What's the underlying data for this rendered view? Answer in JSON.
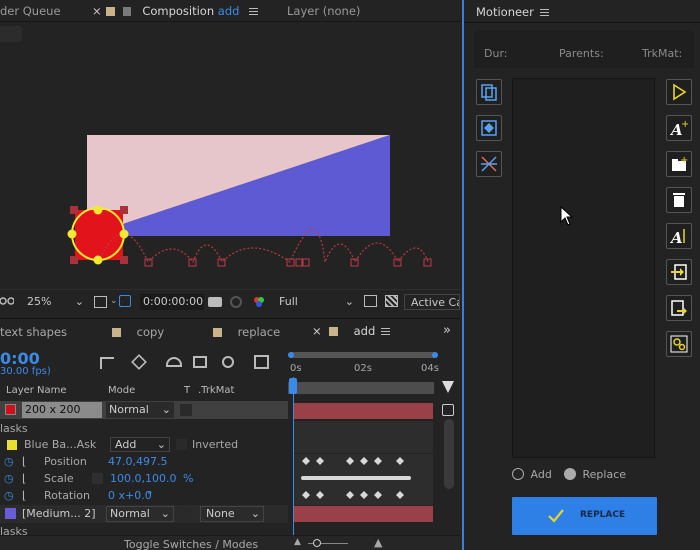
{
  "tabs": {
    "render_queue": "der Queue",
    "composition_prefix": "Composition",
    "composition_name": "add",
    "layer": "Layer (none)"
  },
  "viewer": {
    "zoom": "25%",
    "timecode": "0:00:00:00",
    "resolution": "Full",
    "active_camera": "Active Ca"
  },
  "comp_tabs": [
    {
      "label": "text shapes"
    },
    {
      "label": "copy"
    },
    {
      "label": "replace"
    },
    {
      "label": "add"
    }
  ],
  "timeline": {
    "time": "0:00",
    "fps": "30.00 fps)",
    "ruler": [
      "0s",
      "02s",
      "04s"
    ],
    "col_layer_name": "Layer Name",
    "col_mode": "Mode",
    "col_t": "T",
    "col_trkmat": ".TrkMat",
    "layer1": {
      "name": "200 x 200",
      "mode": "Normal",
      "color": "#d0101a"
    },
    "masks1": "lasks",
    "mask": {
      "name": "Blue Ba...Ask",
      "mode": "Add",
      "inverted": "Inverted",
      "color": "#e8e12c"
    },
    "position": {
      "label": "Position",
      "value": "47.0,497.5"
    },
    "scale": {
      "label": "Scale",
      "value": "100.0,100.0",
      "unit": "%"
    },
    "rotation": {
      "label": "Rotation",
      "value": "0 x+0.0",
      "unit": "°"
    },
    "layer2": {
      "name": "[Medium... 2]",
      "mode": "Normal",
      "trkmat": "None",
      "color": "#6a5bd6"
    },
    "masks2": "lasks",
    "toggle": "Toggle Switches / Modes"
  },
  "panel": {
    "title": "Motioneer",
    "col_dur": "Dur:",
    "col_parents": "Parents:",
    "col_trkmat": "TrkMat:",
    "radio_add": "Add",
    "radio_replace": "Replace",
    "replace_button": "REPLACE",
    "accent": "#3d7fd1",
    "button_color": "#2e7fe6"
  },
  "canvas_colors": {
    "pink": "#e6c6cb",
    "blue": "#5e5ad4",
    "red": "#e3131b",
    "yellow": "#f3e833"
  }
}
